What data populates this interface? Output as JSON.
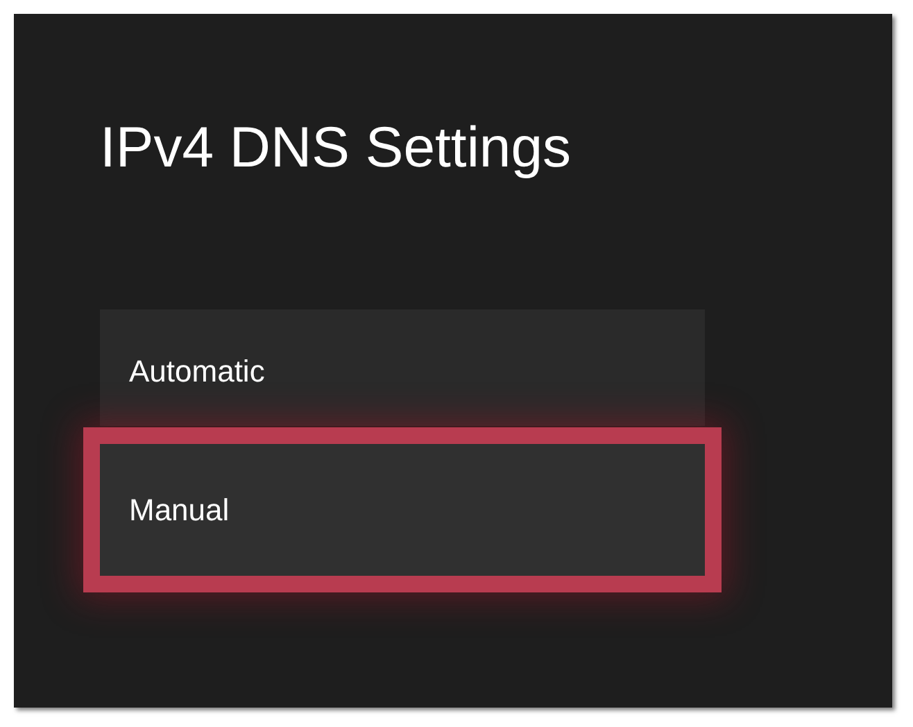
{
  "title": "IPv4 DNS Settings",
  "options": [
    {
      "label": "Automatic",
      "selected": false
    },
    {
      "label": "Manual",
      "selected": true
    }
  ]
}
